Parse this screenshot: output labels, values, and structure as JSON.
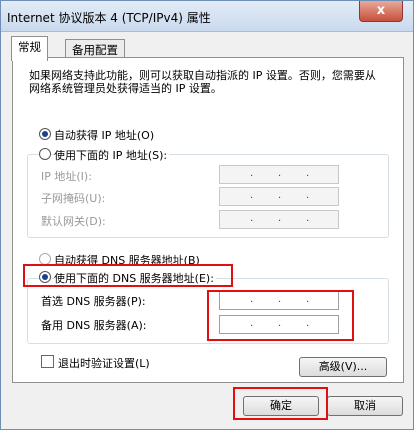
{
  "window": {
    "title": "Internet 协议版本 4 (TCP/IPv4) 属性",
    "close_glyph": "x"
  },
  "tabs": [
    {
      "label": "常规"
    },
    {
      "label": "备用配置"
    }
  ],
  "description": "如果网络支持此功能，则可以获取自动指派的 IP 设置。否则，您需要从网络系统管理员处获得适当的 IP 设置。",
  "ip": {
    "auto_label": "自动获得 IP 地址(O)",
    "manual_label": "使用下面的 IP 地址(S):",
    "fields": [
      {
        "label": "IP 地址(I):"
      },
      {
        "label": "子网掩码(U):"
      },
      {
        "label": "默认网关(D):"
      }
    ]
  },
  "dns": {
    "auto_label": "自动获得 DNS 服务器地址(B)",
    "manual_label": "使用下面的 DNS 服务器地址(E):",
    "preferred_label": "首选 DNS 服务器(P):",
    "alternate_label": "备用 DNS 服务器(A):"
  },
  "validate_label": "退出时验证设置(L)",
  "buttons": {
    "advanced": "高级(V)...",
    "ok": "确定",
    "cancel": "取消"
  },
  "ip_dot": "."
}
